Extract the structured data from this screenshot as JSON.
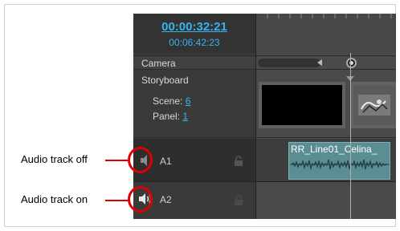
{
  "header": {
    "timecode_current": "00:00:32:21",
    "timecode_total": "00:06:42:23"
  },
  "tracks": {
    "camera_label": "Camera",
    "storyboard_label": "Storyboard",
    "scene_label": "Scene:",
    "scene_value": "6",
    "panel_label": "Panel:",
    "panel_value": "1",
    "audio": [
      {
        "label": "A1",
        "speaker_state": "off",
        "speaker_icon": "speaker-muted-icon",
        "lock_icon": "lock-icon"
      },
      {
        "label": "A2",
        "speaker_state": "on",
        "speaker_icon": "speaker-on-icon",
        "lock_icon": "lock-icon"
      }
    ]
  },
  "timeline": {
    "clip_name": "RR_Line01_Celina_"
  },
  "callouts": {
    "off": "Audio track off",
    "on": "Audio track on"
  },
  "colors": {
    "timecode": "#37b4f0",
    "clip": "#5a8e93",
    "callout": "#e00000"
  }
}
